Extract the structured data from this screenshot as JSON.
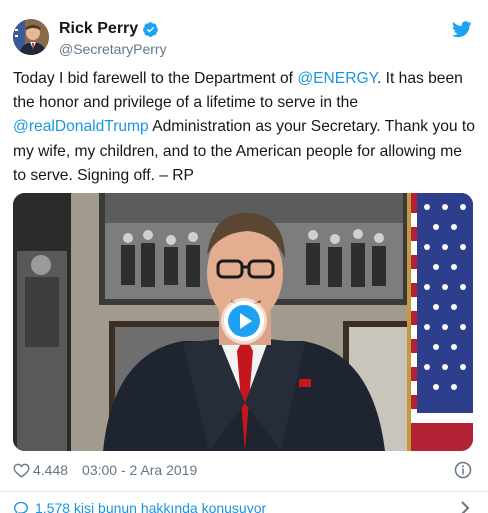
{
  "header": {
    "display_name": "Rick Perry",
    "handle": "@SecretaryPerry"
  },
  "tweet": {
    "part1": "Today I bid farewell to the Department of ",
    "mention1": "@ENERGY",
    "part2": ". It has been the honor and privilege of a lifetime to serve in the ",
    "mention2": "@realDonaldTrump",
    "part3": " Administration as your Secretary. Thank you to my wife, my children, and to the American people for allowing me to serve. Signing off. – RP"
  },
  "meta": {
    "likes": "4.448",
    "timestamp": "03:00 - 2 Ara 2019"
  },
  "conversation": {
    "label": "1.578 kişi bunun hakkında konuşuyor"
  },
  "colors": {
    "link": "#1b95e0",
    "brand_blue": "#1da1f2",
    "secondary_text": "#657786"
  },
  "icons": [
    "verified-badge-icon",
    "twitter-bird-icon",
    "play-icon",
    "heart-icon",
    "info-icon",
    "speech-bubble-icon",
    "chevron-right-icon"
  ]
}
